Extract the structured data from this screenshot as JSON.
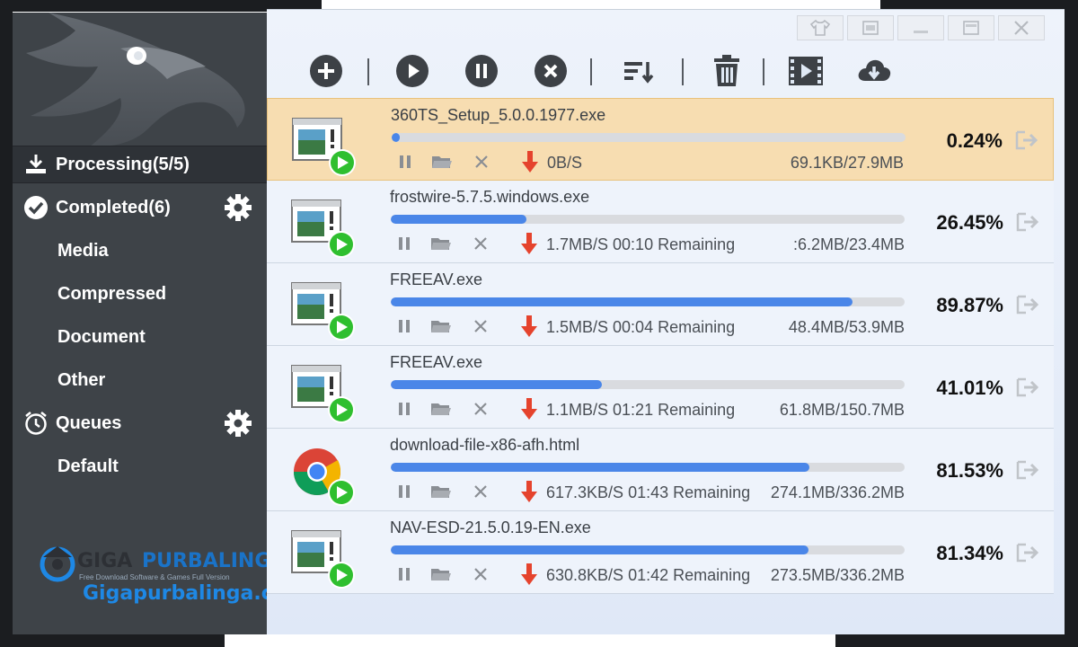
{
  "sidebar": {
    "items": [
      {
        "label": "Processing(5/5)"
      },
      {
        "label": "Completed(6)"
      },
      {
        "label": "Media"
      },
      {
        "label": "Compressed"
      },
      {
        "label": "Document"
      },
      {
        "label": "Other"
      },
      {
        "label": "Queues"
      },
      {
        "label": "Default"
      }
    ]
  },
  "watermark": {
    "brand_part1": "GIGA",
    "brand_part2": "PURBALINGGA",
    "tagline": "Free Download Software & Games Full Version",
    "url": "Gigapurbalinga.cc"
  },
  "toolbar": {
    "icons": [
      "add-icon",
      "play-icon",
      "pause-icon",
      "stop-icon",
      "sort-icon",
      "trash-icon",
      "video-icon",
      "cloud-download-icon"
    ]
  },
  "window_controls": [
    "skin-icon",
    "restore-icon",
    "minimize-icon",
    "maximize-icon",
    "close-icon"
  ],
  "downloads": [
    {
      "name": "360TS_Setup_5.0.0.1977.exe",
      "progress_percent": 0.24,
      "percent_label": "0.24%",
      "speed": "0B/S",
      "size": "69.1KB/27.9MB",
      "icon": "exe-icon",
      "selected": true
    },
    {
      "name": "frostwire-5.7.5.windows.exe",
      "progress_percent": 26.45,
      "percent_label": "26.45%",
      "speed": "1.7MB/S 00:10 Remaining",
      "size": ":6.2MB/23.4MB",
      "icon": "exe-icon",
      "selected": false
    },
    {
      "name": "FREEAV.exe",
      "progress_percent": 89.87,
      "percent_label": "89.87%",
      "speed": "1.5MB/S 00:04 Remaining",
      "size": "48.4MB/53.9MB",
      "icon": "exe-icon",
      "selected": false
    },
    {
      "name": "FREEAV.exe",
      "progress_percent": 41.01,
      "percent_label": "41.01%",
      "speed": "1.1MB/S 01:21 Remaining",
      "size": "61.8MB/150.7MB",
      "icon": "exe-icon",
      "selected": false
    },
    {
      "name": "download-file-x86-afh.html",
      "progress_percent": 81.53,
      "percent_label": "81.53%",
      "speed": "617.3KB/S 01:43 Remaining",
      "size": "274.1MB/336.2MB",
      "icon": "chrome-icon",
      "selected": false
    },
    {
      "name": "NAV-ESD-21.5.0.19-EN.exe",
      "progress_percent": 81.34,
      "percent_label": "81.34%",
      "speed": "630.8KB/S 01:42 Remaining",
      "size": "273.5MB/336.2MB",
      "icon": "exe-icon",
      "selected": false
    }
  ],
  "colors": {
    "sidebar_bg": "#3e4348",
    "selected_row_bg": "#f7ddb1",
    "progress_fill": "#4a86e8",
    "speed_arrow": "#e5432d",
    "play_badge": "#2fbf2f"
  }
}
